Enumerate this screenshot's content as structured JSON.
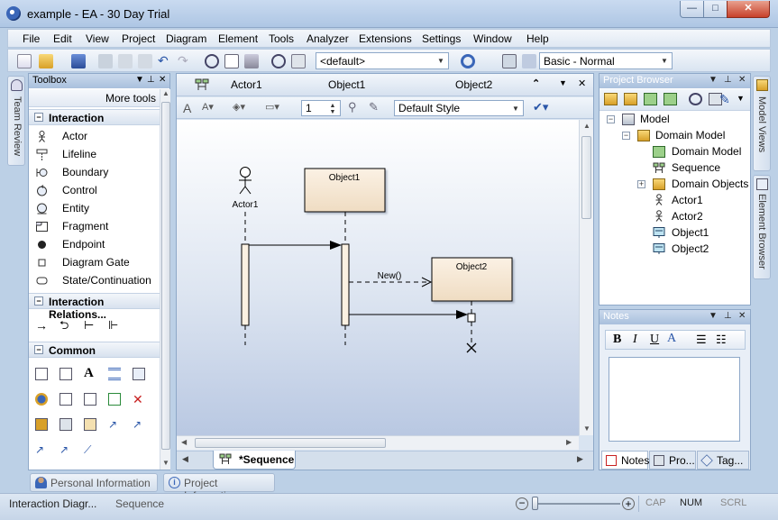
{
  "window": {
    "title": "example - EA - 30 Day Trial",
    "min_glyph": "—",
    "max_glyph": "□",
    "close_glyph": "✕"
  },
  "menu": [
    "File",
    "Edit",
    "View",
    "Project",
    "Diagram",
    "Element",
    "Tools",
    "Analyzer",
    "Extensions",
    "Settings",
    "Window",
    "Help"
  ],
  "toolbar": {
    "default_combo": "<default>",
    "workspace_combo": "Basic - Normal"
  },
  "left_tab": {
    "label": "Team Review"
  },
  "toolbox": {
    "title": "Toolbox",
    "more_tools": "More tools",
    "sections": [
      {
        "label": "Interaction",
        "items": [
          "Actor",
          "Lifeline",
          "Boundary",
          "Control",
          "Entity",
          "Fragment",
          "Endpoint",
          "Diagram Gate",
          "State/Continuation"
        ]
      },
      {
        "label": "Interaction Relations..."
      },
      {
        "label": "Common"
      }
    ]
  },
  "diagram": {
    "header_items": [
      "Actor1",
      "Object1",
      "Object2"
    ],
    "zoom_value": "1",
    "style_combo": "Default Style",
    "tab_label": "*Sequence",
    "actor_label": "Actor1",
    "object1_label": "Object1",
    "object2_label": "Object2",
    "message_new": "New()"
  },
  "project_browser": {
    "title": "Project Browser",
    "tree": [
      "Model",
      "Domain Model",
      "Domain Model",
      "Sequence",
      "Domain Objects",
      "Actor1",
      "Actor2",
      "Object1",
      "Object2"
    ]
  },
  "notes": {
    "title": "Notes",
    "format_buttons": [
      "B",
      "I",
      "U"
    ],
    "tabs": [
      "Notes",
      "Pro...",
      "Tag..."
    ]
  },
  "right_tabs": [
    "Model Views",
    "Element Browser"
  ],
  "bottom_tabs": [
    "Personal Information",
    "Project Information"
  ],
  "status": {
    "left": "Interaction Diagr...",
    "middle": "Sequence",
    "indicators": [
      "CAP",
      "NUM",
      "SCRL"
    ]
  }
}
